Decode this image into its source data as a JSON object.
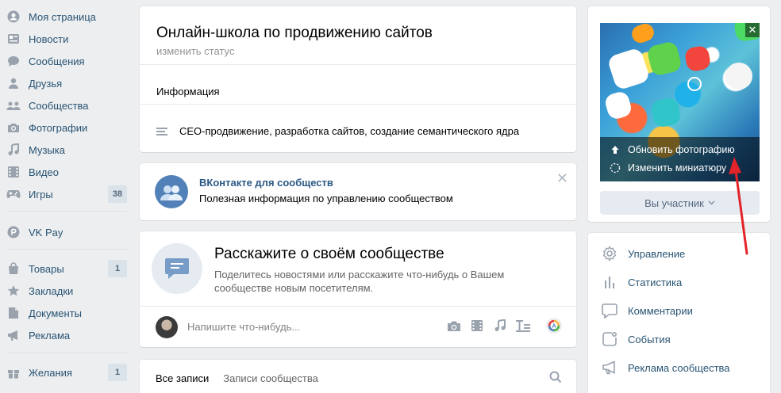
{
  "left_menu": {
    "items": [
      {
        "label": "Моя страница",
        "icon": "user-circle-icon"
      },
      {
        "label": "Новости",
        "icon": "news-icon"
      },
      {
        "label": "Сообщения",
        "icon": "message-icon"
      },
      {
        "label": "Друзья",
        "icon": "friends-icon"
      },
      {
        "label": "Сообщества",
        "icon": "groups-icon"
      },
      {
        "label": "Фотографии",
        "icon": "camera-icon"
      },
      {
        "label": "Музыка",
        "icon": "music-icon"
      },
      {
        "label": "Видео",
        "icon": "video-icon"
      },
      {
        "label": "Игры",
        "icon": "gamepad-icon",
        "count": "38"
      },
      {
        "label": "VK Pay",
        "icon": "vkpay-icon"
      },
      {
        "label": "Товары",
        "icon": "bag-icon",
        "count": "1"
      },
      {
        "label": "Закладки",
        "icon": "star-icon"
      },
      {
        "label": "Документы",
        "icon": "document-icon"
      },
      {
        "label": "Реклама",
        "icon": "megaphone-icon"
      },
      {
        "label": "Желания",
        "icon": "gift-icon",
        "count": "1"
      }
    ]
  },
  "profile": {
    "title": "Онлайн-школа по продвижению сайтов",
    "status_link": "изменить статус",
    "info_label": "Информация",
    "description": "СЕО-продвижение, разработка сайтов, создание семантического ядра"
  },
  "promo": {
    "title": "ВКонтакте для сообществ",
    "text": "Полезная информация по управлению сообществом"
  },
  "post_box": {
    "heading": "Расскажите о своём сообществе",
    "subtext": "Поделитесь новостями или расскажите что-нибудь о Вашем сообществе новым посетителям.",
    "placeholder": "Напишите что-нибудь..."
  },
  "wall_tabs": {
    "all": "Все записи",
    "community": "Записи сообщества"
  },
  "photo_menu": {
    "update": "Обновить фотографию",
    "thumbnail": "Изменить миниатюру"
  },
  "member_button": "Вы участник",
  "manage_menu": [
    {
      "label": "Управление",
      "icon": "gear-icon"
    },
    {
      "label": "Статистика",
      "icon": "stats-icon"
    },
    {
      "label": "Комментарии",
      "icon": "comment-icon"
    },
    {
      "label": "События",
      "icon": "events-icon"
    },
    {
      "label": "Реклама сообщества",
      "icon": "megaphone-icon"
    }
  ],
  "colors": {
    "background": "#edeef0",
    "link": "#285473",
    "accent": "#5181b8",
    "arrow": "#e3232a"
  }
}
